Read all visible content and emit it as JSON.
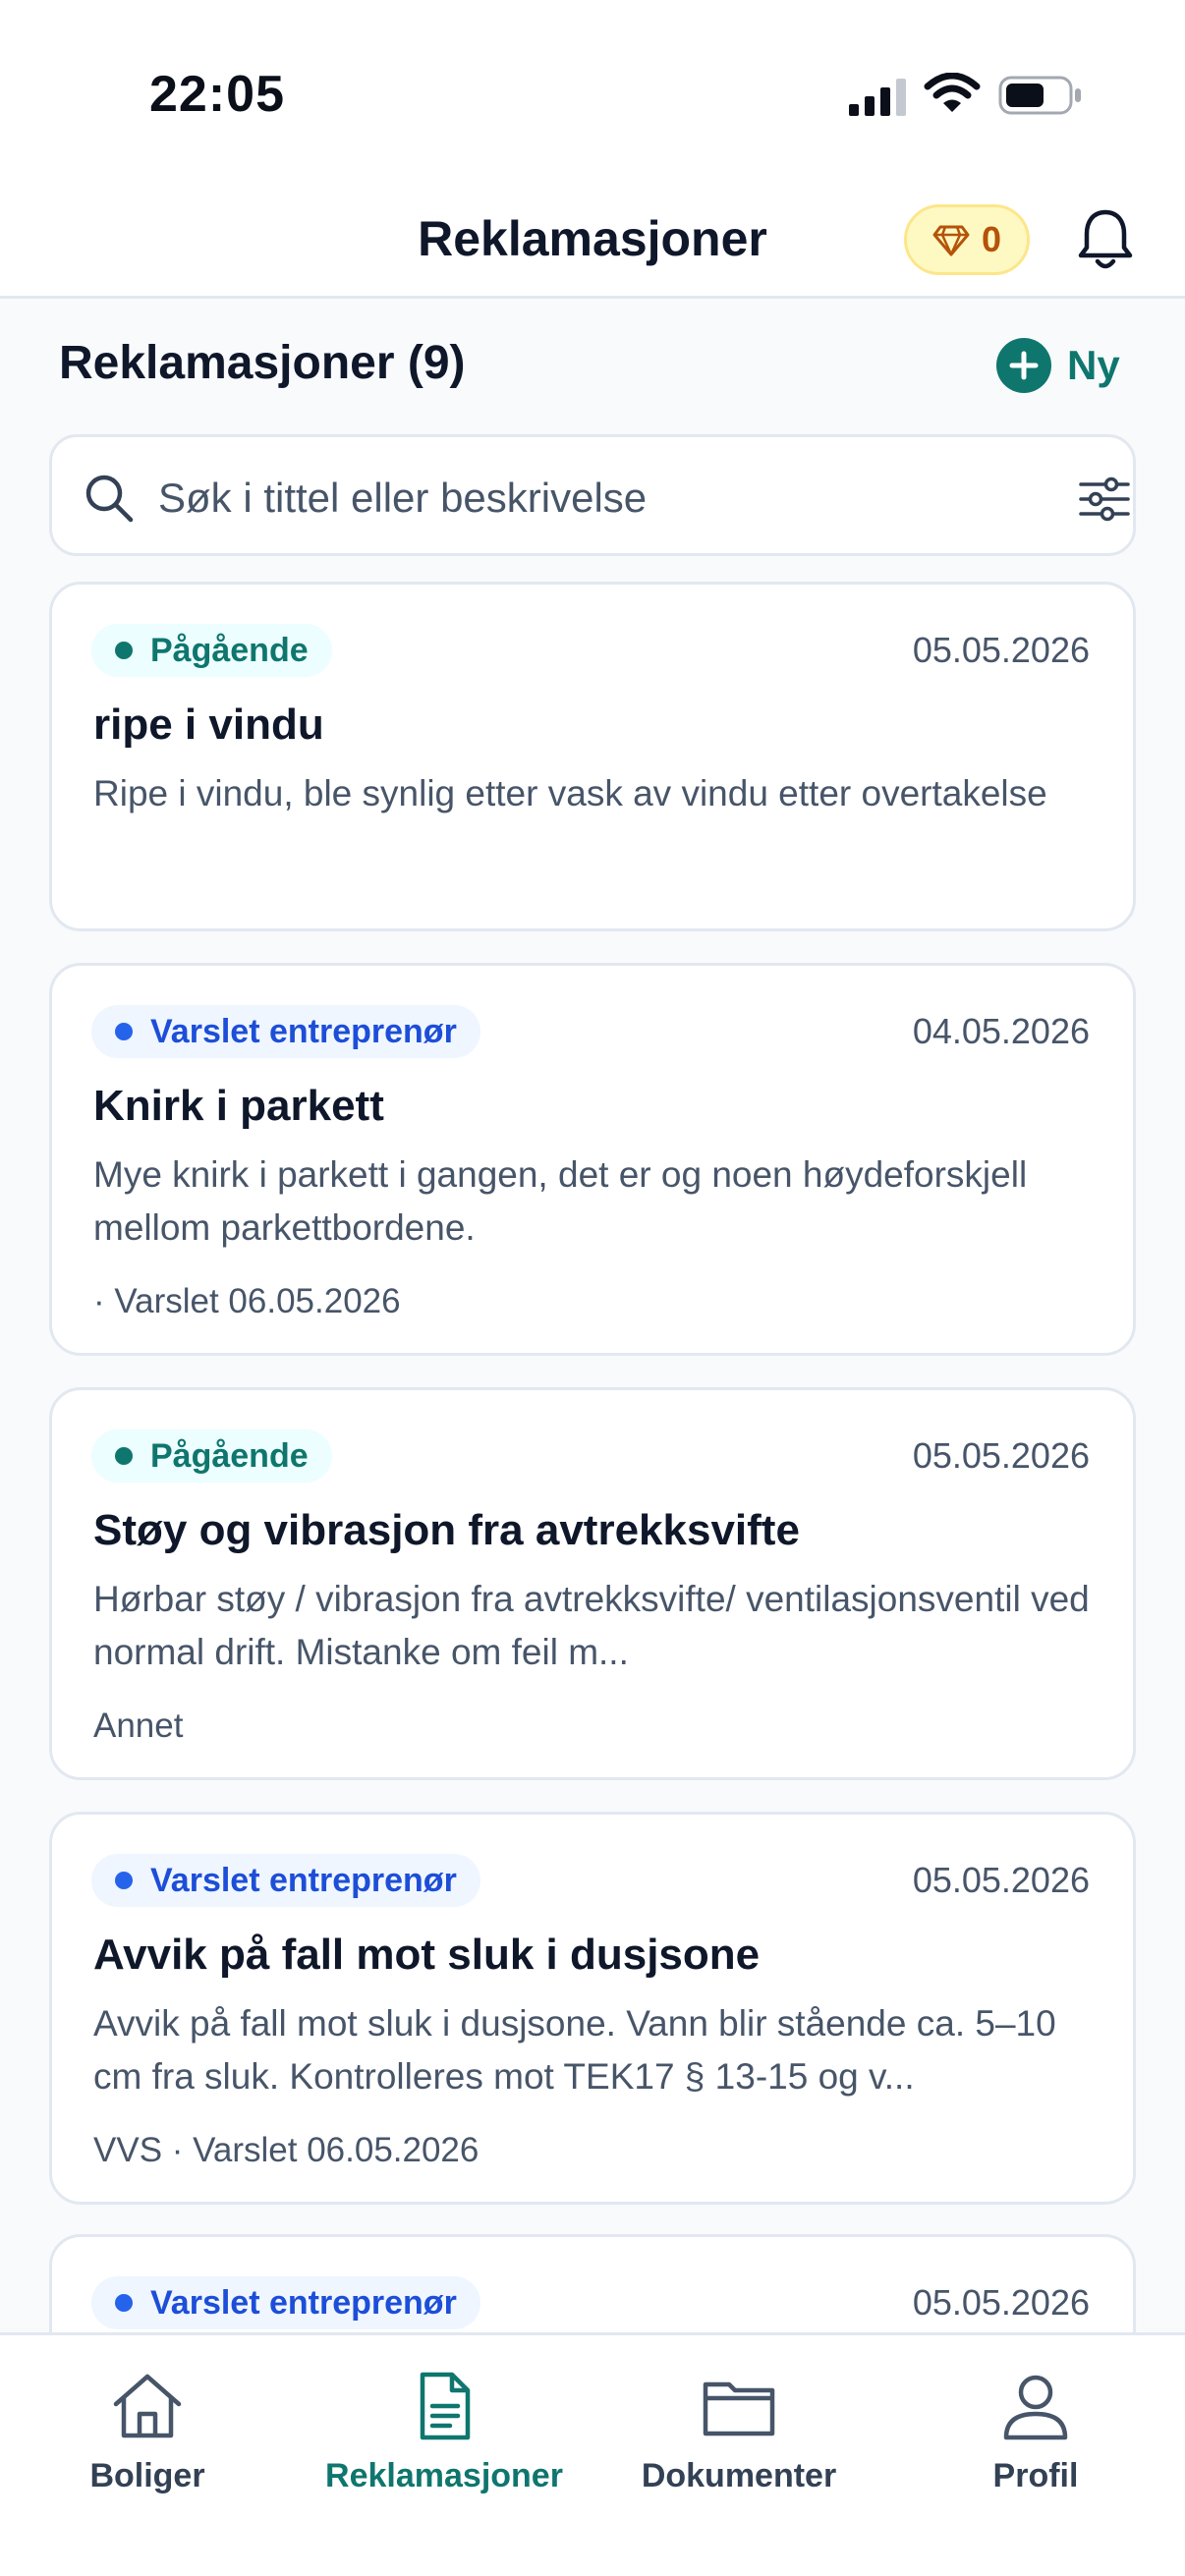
{
  "status_bar": {
    "time": "22:05"
  },
  "header": {
    "title": "Reklamasjoner",
    "points": "0"
  },
  "section": {
    "title": "Reklamasjoner (9)",
    "new_label": "Ny"
  },
  "search": {
    "placeholder": "Søk i tittel eller beskrivelse",
    "value": ""
  },
  "cards": [
    {
      "status": "Pågående",
      "date": "05.05.2026",
      "title": "ripe i vindu",
      "description": "Ripe i vindu, ble synlig etter vask av vindu etter overtakelse",
      "meta": ""
    },
    {
      "status": "Varslet entreprenør",
      "date": "04.05.2026",
      "title": "Knirk i parkett",
      "description": "Mye knirk i parkett i gangen, det er og noen høydeforskjell mellom parkettbordene.",
      "meta": "· Varslet 06.05.2026"
    },
    {
      "status": "Pågående",
      "date": "05.05.2026",
      "title": "Støy og vibrasjon fra avtrekksvifte",
      "description": "Hørbar støy / vibrasjon fra avtrekksvifte/ ventilasjonsventil ved normal drift. Mistanke om feil m...",
      "meta": "Annet"
    },
    {
      "status": "Varslet entreprenør",
      "date": "05.05.2026",
      "title": "Avvik på fall mot sluk i dusjsone",
      "description": "Avvik på fall mot sluk i dusjsone. Vann blir stående ca. 5–10 cm fra sluk. Kontrolleres mot TEK17 § 13-15 og v...",
      "meta": "VVS  · Varslet 06.05.2026"
    },
    {
      "status": "Varslet entreprenør",
      "date": "05.05.2026",
      "title": "",
      "description": "",
      "meta": ""
    }
  ],
  "nav": {
    "items": [
      {
        "label": "Boliger",
        "icon": "home-icon"
      },
      {
        "label": "Reklamasjoner",
        "icon": "document-icon",
        "active": true
      },
      {
        "label": "Dokumenter",
        "icon": "folder-icon"
      },
      {
        "label": "Profil",
        "icon": "user-icon"
      }
    ]
  },
  "colors": {
    "accent": "#0f766e",
    "notified": "#1d4ed8",
    "text_primary": "#0f172a",
    "text_secondary": "#475569",
    "background": "#f8fafc"
  }
}
